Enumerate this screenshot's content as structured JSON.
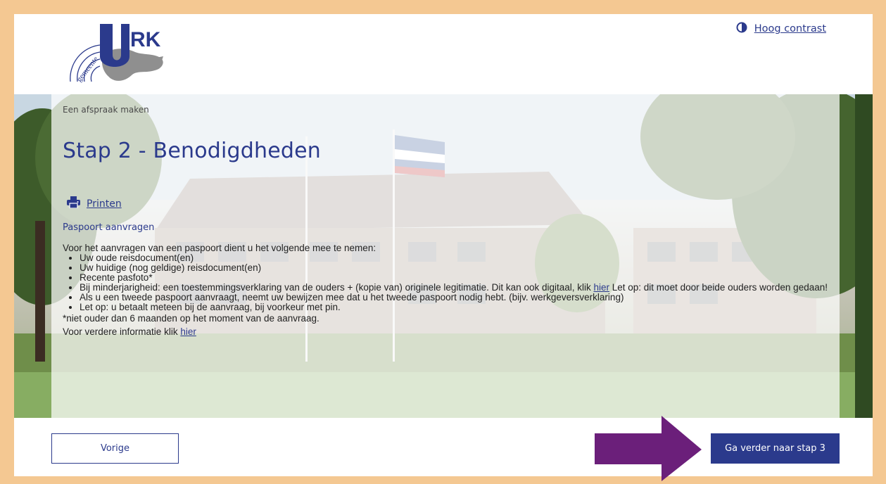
{
  "header": {
    "logo_text": "URK",
    "logo_subtext": "gemeente",
    "contrast_label": "Hoog contrast",
    "contrast_icon": "contrast-icon"
  },
  "breadcrumb": "Een afspraak maken",
  "page_title": "Stap 2 - Benodigdheden",
  "print": {
    "label": "Printen",
    "icon": "printer-icon"
  },
  "section_title": "Paspoort aanvragen",
  "content": {
    "intro": "Voor het aanvragen van een paspoort dient u het volgende mee te nemen:",
    "items": [
      "Uw oude reisdocument(en)",
      "Uw huidige (nog geldige) reisdocument(en)",
      "Recente pasfoto*"
    ],
    "item4_before": "Bij minderjarigheid: een toestemmingsverklaring van de ouders + (kopie van) originele legitimatie. Dit kan ook digitaal, klik ",
    "item4_link": "hier",
    "item4_after": " Let op: dit moet door beide ouders worden gedaan!",
    "item5": "Als u een tweede paspoort aanvraagt, neemt uw bewijzen mee dat u het tweede paspoort nodig hebt. (bijv. werkgeversverklaring)",
    "item6": "Let op: u betaalt meteen bij de aanvraag, bij voorkeur met pin.",
    "note": "*niet ouder dan 6 maanden op het moment van de aanvraag.",
    "more_before": "Voor verdere informatie klik ",
    "more_link": "hier"
  },
  "footer": {
    "prev_label": "Vorige",
    "next_label": "Ga verder naar stap 3"
  },
  "colors": {
    "brand": "#2b3a8c",
    "frame": "#f4c892",
    "arrow": "#6b1f7a"
  }
}
